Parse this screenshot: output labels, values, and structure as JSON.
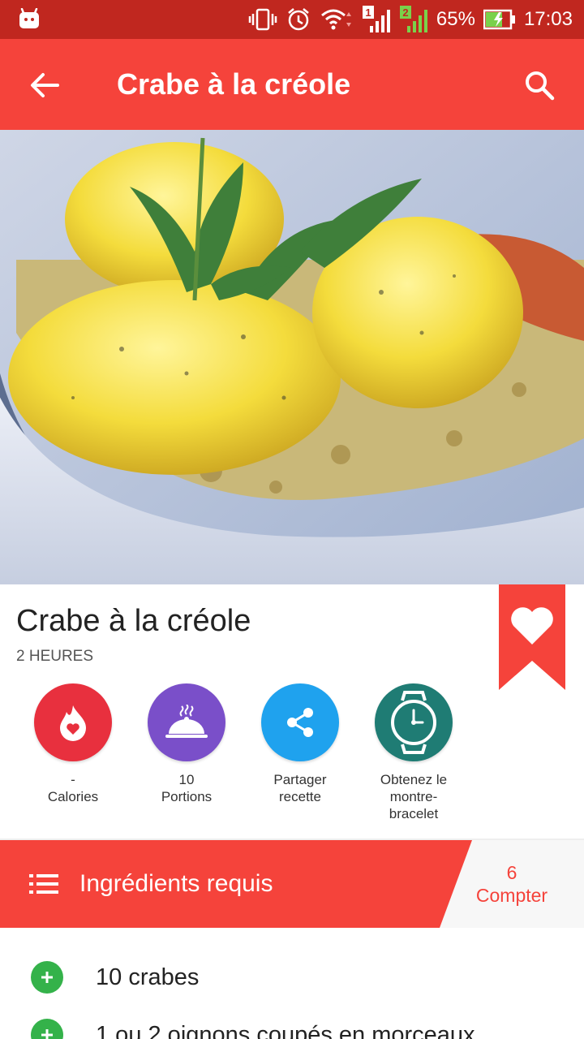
{
  "status_bar": {
    "battery": "65%",
    "time": "17:03",
    "sim1": "1",
    "sim2": "2",
    "colors": {
      "background": "#c0271f"
    }
  },
  "app_bar": {
    "title": "Crabe à la créole",
    "back_icon": "arrow-left-icon",
    "search_icon": "search-icon",
    "color": "#f5433b"
  },
  "recipe": {
    "title": "Crabe à la créole",
    "duration": "2 HEURES",
    "favorite_icon": "heart-icon"
  },
  "actions": [
    {
      "icon": "flame-heart-icon",
      "line1": "-",
      "line2": "Calories",
      "color": "#e8303e"
    },
    {
      "icon": "serving-dish-icon",
      "line1": "10",
      "line2": "Portions",
      "color": "#7a4fc9"
    },
    {
      "icon": "share-icon",
      "line1": "Partager",
      "line2": "recette",
      "color": "#1fa2ee"
    },
    {
      "icon": "watch-icon",
      "line1": "Obtenez le",
      "line2": "montre-",
      "line3": "bracelet",
      "color": "#1f7c74"
    }
  ],
  "ingredients": {
    "header": "Ingrédients requis",
    "count_value": "6",
    "count_label": "Compter",
    "items": [
      "10 crabes",
      "1 ou 2 oignons coupés en morceaux"
    ]
  }
}
